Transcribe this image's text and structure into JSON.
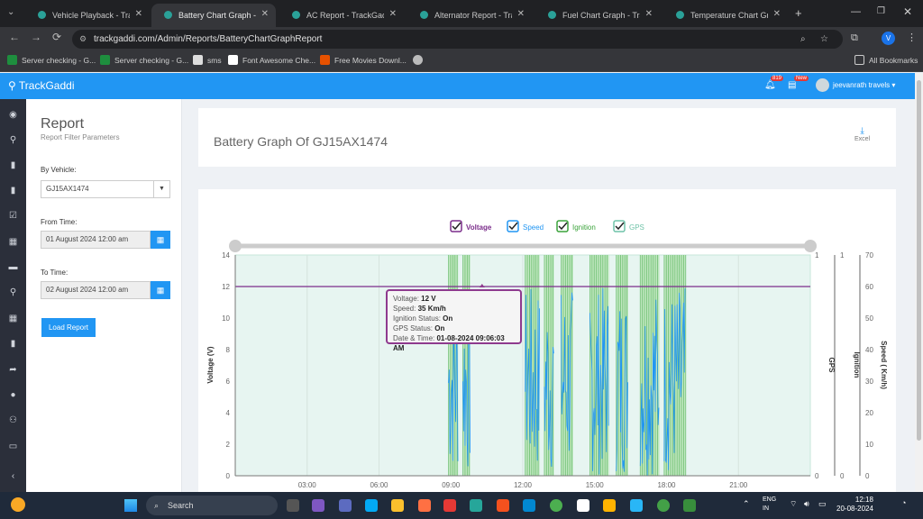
{
  "browser": {
    "tabs": [
      {
        "label": "Vehicle Playback - TrackGaddi",
        "active": false
      },
      {
        "label": "Battery Chart Graph - TrackGaddi",
        "active": true
      },
      {
        "label": "AC Report - TrackGaddi",
        "active": false
      },
      {
        "label": "Alternator Report - TrackGaddi",
        "active": false
      },
      {
        "label": "Fuel Chart Graph - TrackGaddi",
        "active": false
      },
      {
        "label": "Temperature Chart Graph",
        "active": false
      }
    ],
    "url": "trackgaddi.com/Admin/Reports/BatteryChartGraphReport",
    "profile_initial": "V",
    "bookmarks": [
      "Server checking - G...",
      "Server checking - G...",
      "sms",
      "Font Awesome Che...",
      "Free Movies Downl..."
    ],
    "all_bookmarks": "All Bookmarks"
  },
  "app": {
    "brand": "TrackGaddi",
    "notif_badge": "819",
    "new_badge": "New",
    "user": "jeevanrath travels"
  },
  "filter": {
    "title": "Report",
    "subtitle": "Report Filter Parameters",
    "vehicle_label": "By Vehicle:",
    "vehicle_value": "GJ15AX1474",
    "from_label": "From Time:",
    "from_value": "01 August 2024 12:00 am",
    "to_label": "To Time:",
    "to_value": "02 August 2024 12:00 am",
    "load_button": "Load Report"
  },
  "report": {
    "title": "Battery Graph Of GJ15AX1474",
    "excel_label": "Excel"
  },
  "tooltip": {
    "voltage_label": "Voltage:",
    "voltage_value": "12 V",
    "speed_label": "Speed:",
    "speed_value": "35 Km/h",
    "ignition_label": "Ignition Status:",
    "ignition_value": "On",
    "gps_label": "GPS Status:",
    "gps_value": "On",
    "datetime_label": "Date & Time:",
    "datetime_value": "01-08-2024 09:06:03 AM"
  },
  "chart_data": {
    "type": "line",
    "legend": [
      {
        "name": "Voltage",
        "color": "#7b2d8b"
      },
      {
        "name": "Speed",
        "color": "#2196f3"
      },
      {
        "name": "Ignition",
        "color": "#3aa33a"
      },
      {
        "name": "GPS",
        "color": "#6fc3a8"
      }
    ],
    "x_ticks": [
      "03:00",
      "06:00",
      "09:00",
      "12:00",
      "15:00",
      "18:00",
      "21:00"
    ],
    "x_range_hours": [
      0,
      24
    ],
    "voltage_axis": {
      "label": "Voltage (V)",
      "ticks": [
        "0",
        "2",
        "4",
        "6",
        "8",
        "10",
        "12",
        "14"
      ],
      "ylim": [
        0,
        14
      ]
    },
    "gps_axis": {
      "label": "GPS",
      "ticks": [
        "0",
        "1"
      ],
      "ylim": [
        0,
        1
      ]
    },
    "ignition_axis": {
      "label": "Ignition",
      "ticks": [
        "0",
        "1"
      ],
      "ylim": [
        0,
        1
      ]
    },
    "speed_axis": {
      "label": "Speed ( Km/h)",
      "ticks": [
        "0",
        "10",
        "20",
        "30",
        "40",
        "50",
        "60",
        "70"
      ],
      "ylim": [
        0,
        70
      ]
    },
    "series": [
      {
        "name": "Voltage",
        "x_hours": [
          0,
          24
        ],
        "values": [
          12,
          12
        ]
      },
      {
        "name": "Ignition",
        "on_intervals_hours": [
          [
            8.9,
            9.3
          ],
          [
            9.5,
            9.8
          ],
          [
            12.1,
            12.7
          ],
          [
            12.9,
            13.3
          ],
          [
            13.6,
            14.1
          ],
          [
            14.8,
            15.6
          ],
          [
            15.9,
            16.4
          ],
          [
            16.9,
            17.7
          ],
          [
            17.9,
            18.8
          ]
        ]
      },
      {
        "name": "Speed",
        "active_intervals_hours": [
          [
            8.9,
            9.3
          ],
          [
            9.5,
            9.8
          ],
          [
            12.1,
            12.7
          ],
          [
            12.9,
            13.3
          ],
          [
            13.6,
            14.1
          ],
          [
            14.8,
            15.6
          ],
          [
            15.9,
            16.4
          ],
          [
            16.9,
            17.7
          ],
          [
            17.9,
            18.8
          ]
        ],
        "max_value": 60
      }
    ]
  }
}
